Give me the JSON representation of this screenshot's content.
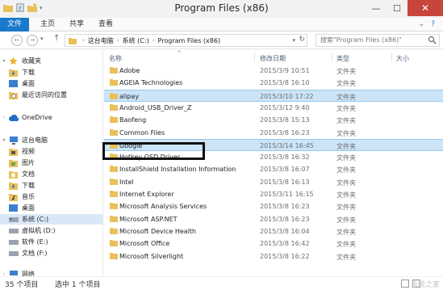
{
  "window": {
    "title": "Program Files (x86)",
    "minimize": "—",
    "maximize": "☐",
    "close": "✕"
  },
  "ribbon": {
    "tabs": [
      "文件",
      "主页",
      "共享",
      "查看"
    ],
    "expand": "⌄",
    "help": "?"
  },
  "address": {
    "crumbs": [
      "这台电脑",
      "系统 (C:)",
      "Program Files (x86)"
    ],
    "search_placeholder": "搜索\"Program Files (x86)\""
  },
  "navpane": {
    "favorites": "收藏夹",
    "favorites_items": [
      "下载",
      "桌面",
      "最近访问的位置"
    ],
    "onedrive": "OneDrive",
    "thispc": "这台电脑",
    "thispc_items": [
      "视频",
      "图片",
      "文档",
      "下载",
      "音乐",
      "桌面",
      "系统 (C:)",
      "虚拟机 (D:)",
      "软件 (E:)",
      "文档 (F:)"
    ],
    "network_partial": "网络"
  },
  "columns": {
    "name": "名称",
    "date": "修改日期",
    "type": "类型",
    "size": "大小"
  },
  "files": [
    {
      "name": "Adobe",
      "date": "2015/3/9 10:51",
      "type": "文件夹"
    },
    {
      "name": "AGEIA Technologies",
      "date": "2015/3/8 16:10",
      "type": "文件夹"
    },
    {
      "name": "alipay",
      "date": "2015/3/10 17:22",
      "type": "文件夹"
    },
    {
      "name": "Android_USB_Driver_Z",
      "date": "2015/3/12 9:40",
      "type": "文件夹"
    },
    {
      "name": "Baofeng",
      "date": "2015/3/8 15:13",
      "type": "文件夹"
    },
    {
      "name": "Common Files",
      "date": "2015/3/8 16:23",
      "type": "文件夹"
    },
    {
      "name": "Google",
      "date": "2015/3/14 16:45",
      "type": "文件夹"
    },
    {
      "name": "Hotkey OSD Driver",
      "date": "2015/3/8 16:32",
      "type": "文件夹"
    },
    {
      "name": "InstallShield Installation Information",
      "date": "2015/3/8 16:07",
      "type": "文件夹"
    },
    {
      "name": "Intel",
      "date": "2015/3/8 16:13",
      "type": "文件夹"
    },
    {
      "name": "Internet Explorer",
      "date": "2015/3/11 16:15",
      "type": "文件夹"
    },
    {
      "name": "Microsoft Analysis Services",
      "date": "2015/3/8 16:23",
      "type": "文件夹"
    },
    {
      "name": "Microsoft ASP.NET",
      "date": "2015/3/8 16:23",
      "type": "文件夹"
    },
    {
      "name": "Microsoft Device Health",
      "date": "2015/3/8 16:04",
      "type": "文件夹"
    },
    {
      "name": "Microsoft Office",
      "date": "2015/3/8 16:42",
      "type": "文件夹"
    },
    {
      "name": "Microsoft Silverlight",
      "date": "2015/3/8 16:22",
      "type": "文件夹"
    }
  ],
  "status": {
    "count": "35 个项目",
    "selected": "选中 1 个项目",
    "watermark": "系统之家"
  },
  "colors": {
    "accent": "#1979ca",
    "selection": "#cce4f7",
    "folder": "#e8c15a",
    "close": "#c7453b"
  }
}
